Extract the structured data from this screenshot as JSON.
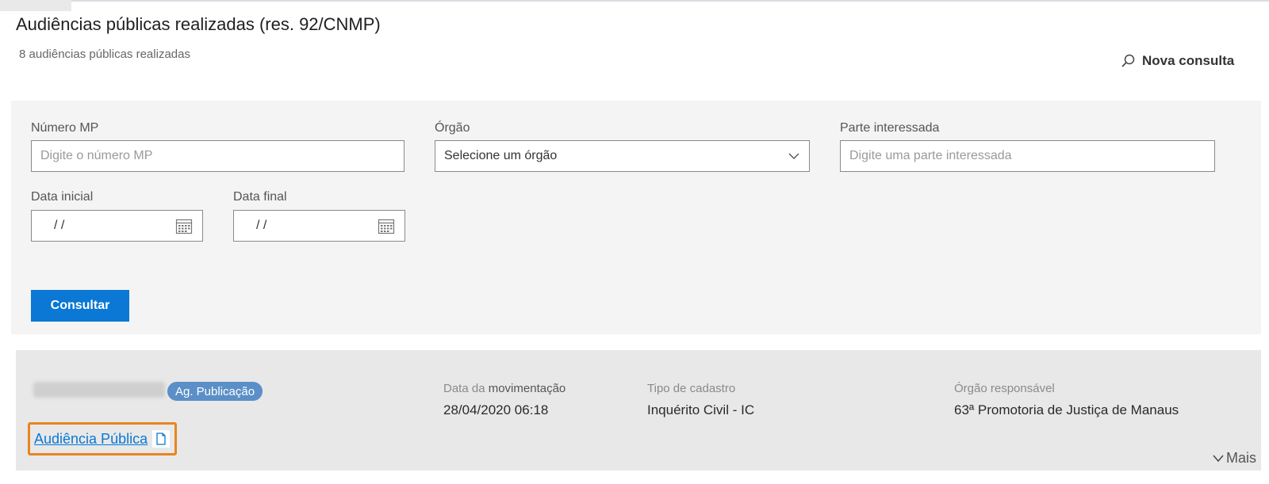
{
  "header": {
    "title": "Audiências públicas realizadas (res. 92/CNMP)",
    "subtitle": "8 audiências públicas realizadas",
    "nova_consulta": "Nova consulta"
  },
  "filters": {
    "numero_mp": {
      "label": "Número MP",
      "placeholder": "Digite o número MP"
    },
    "orgao": {
      "label": "Órgão",
      "value": "Selecione um órgão"
    },
    "parte": {
      "label": "Parte interessada",
      "placeholder": "Digite uma parte interessada"
    },
    "data_inicial": {
      "label": "Data inicial",
      "value": "/   /"
    },
    "data_final": {
      "label": "Data final",
      "value": "/   /"
    },
    "submit_label": "Consultar"
  },
  "result": {
    "status_badge": "Ag. Publicação",
    "data_label_prefix": "Data da",
    "data_label_strong": "movimentação",
    "data_value": "28/04/2020 06:18",
    "tipo_label": "Tipo de cadastro",
    "tipo_value": "Inquérito Civil - IC",
    "orgao_label": "Órgão responsável",
    "orgao_value": "63ª Promotoria de Justiça de Manaus",
    "link_label": "Audiência Pública",
    "mais_label": "Mais"
  },
  "colors": {
    "primary": "#0a78d4",
    "badge": "#5b8fc7",
    "highlight": "#e8841f"
  }
}
